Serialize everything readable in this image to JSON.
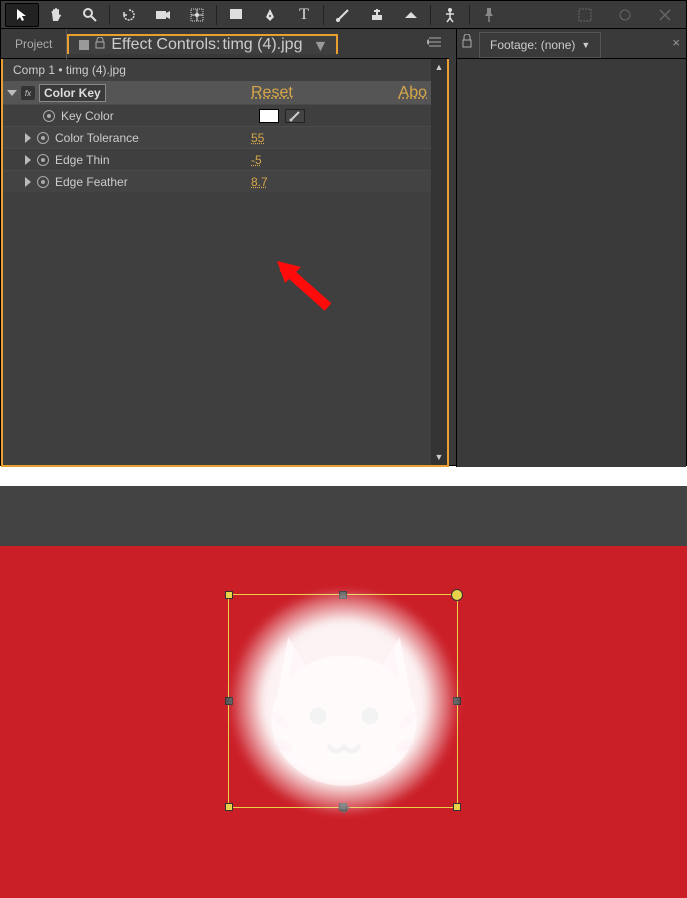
{
  "toolbar": {
    "tools": [
      "arrow",
      "hand",
      "zoom",
      "rotate",
      "camera",
      "anchor",
      "rect",
      "pen",
      "type",
      "brush",
      "clone",
      "eraser",
      "puppet",
      "pin"
    ]
  },
  "tabs": {
    "project": "Project",
    "effect_controls_prefix": "Effect Controls: ",
    "effect_controls_file": "timg (4).jpg",
    "footage": "Footage: (none)"
  },
  "comp_path": "Comp 1 • timg (4).jpg",
  "effect": {
    "name": "Color Key",
    "reset": "Reset",
    "about": "Abo",
    "props": {
      "key_color": {
        "label": "Key Color"
      },
      "color_tolerance": {
        "label": "Color Tolerance",
        "value": "55"
      },
      "edge_thin": {
        "label": "Edge Thin",
        "value": "-5"
      },
      "edge_feather": {
        "label": "Edge Feather",
        "value": "8.7"
      }
    }
  },
  "annotation": {
    "target": "edge_feather_value"
  }
}
